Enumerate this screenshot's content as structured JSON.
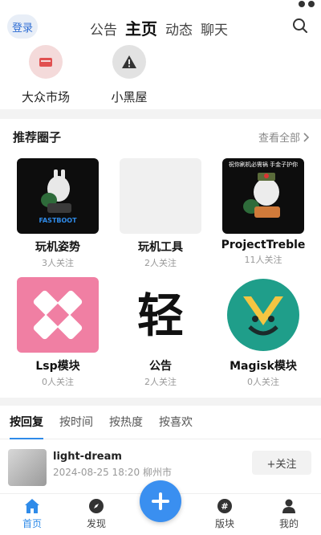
{
  "header": {
    "login_label": "登录",
    "tabs": [
      {
        "label": "公告"
      },
      {
        "label": "主页"
      },
      {
        "label": "动态"
      },
      {
        "label": "聊天"
      }
    ],
    "active_tab": "主页"
  },
  "shortcuts": [
    {
      "label": "大众市场",
      "icon": "store-icon"
    },
    {
      "label": "小黑屋",
      "icon": "warning-icon"
    }
  ],
  "circles": {
    "title": "推荐圈子",
    "view_all": "查看全部",
    "items": [
      {
        "name": "玩机姿势",
        "count": "3人关注",
        "thumb_text": "FASTBOOT"
      },
      {
        "name": "玩机工具",
        "count": "2人关注",
        "thumb_text": ""
      },
      {
        "name": "ProjectTreble",
        "count": "11人关注",
        "thumb_text": "祝你刷机必需祸 手金子护你"
      },
      {
        "name": "Lsp模块",
        "count": "0人关注",
        "thumb_text": ""
      },
      {
        "name": "公告",
        "count": "2人关注",
        "thumb_text": "轻"
      },
      {
        "name": "Magisk模块",
        "count": "0人关注",
        "thumb_text": ""
      }
    ]
  },
  "sort_tabs": [
    {
      "label": "按回复"
    },
    {
      "label": "按时间"
    },
    {
      "label": "按热度"
    },
    {
      "label": "按喜欢"
    }
  ],
  "post": {
    "user": "light-dream",
    "meta": "2024-08-25 18:20 柳州市",
    "follow_label": "+关注"
  },
  "bottom_nav": [
    {
      "label": "首页"
    },
    {
      "label": "发现"
    },
    {
      "label": "版块"
    },
    {
      "label": "我的"
    }
  ],
  "colors": {
    "accent": "#2f8be9",
    "login_bg": "#e8eef7",
    "fab": "#3a8ff0"
  }
}
